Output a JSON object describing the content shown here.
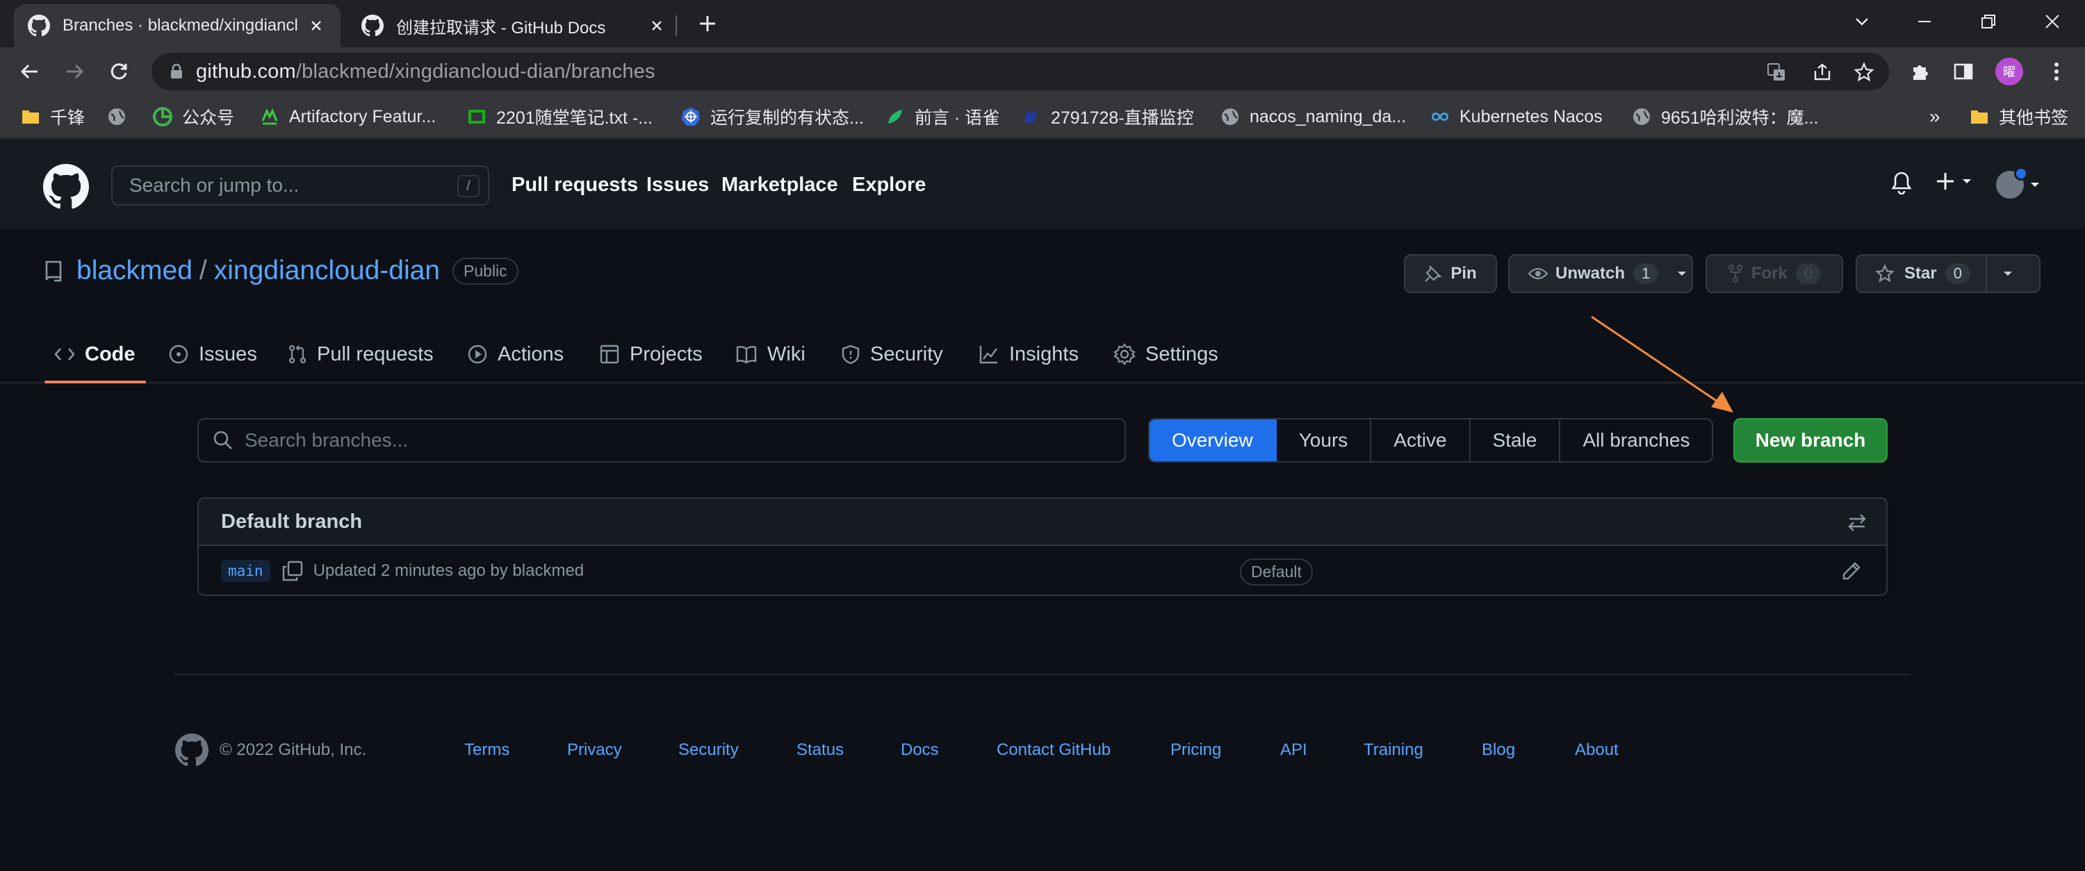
{
  "browser": {
    "tabs": [
      {
        "title": "Branches · blackmed/xingdiancloud-dian",
        "active": true
      },
      {
        "title": "创建拉取请求 - GitHub Docs",
        "active": false
      }
    ],
    "url_host": "github.com",
    "url_path": "/blackmed/xingdiancloud-dian/branches",
    "profile_initial": "曜",
    "bookmarks": [
      {
        "label": "千锋",
        "icon": "folder-icon"
      },
      {
        "label": "",
        "icon": "globe-icon"
      },
      {
        "label": "公众号",
        "icon": "wechat-icon"
      },
      {
        "label": "Artifactory Featur...",
        "icon": "artifactory-icon"
      },
      {
        "label": "2201随堂笔记.txt -...",
        "icon": "note-icon"
      },
      {
        "label": "运行复制的有状态...",
        "icon": "kubernetes-icon"
      },
      {
        "label": "前言 · 语雀",
        "icon": "yuque-icon"
      },
      {
        "label": "2791728-直播监控",
        "icon": "live-icon"
      },
      {
        "label": "nacos_naming_da...",
        "icon": "globe-icon"
      },
      {
        "label": "Kubernetes Nacos",
        "icon": "infinity-icon"
      },
      {
        "label": "9651哈利波特：魔...",
        "icon": "globe-icon"
      },
      {
        "label": "其他书签",
        "icon": "folder-icon"
      }
    ],
    "more_bookmarks": "»"
  },
  "github": {
    "search_placeholder": "Search or jump to...",
    "search_shortcut": "/",
    "nav": [
      "Pull requests",
      "Issues",
      "Marketplace",
      "Explore"
    ]
  },
  "repo": {
    "owner": "blackmed",
    "separator": "/",
    "name": "xingdiancloud-dian",
    "visibility": "Public",
    "pin_label": "Pin",
    "unwatch_label": "Unwatch",
    "unwatch_count": "1",
    "fork_label": "Fork",
    "fork_count": "0",
    "star_label": "Star",
    "star_count": "0",
    "tabs": [
      "Code",
      "Issues",
      "Pull requests",
      "Actions",
      "Projects",
      "Wiki",
      "Security",
      "Insights",
      "Settings"
    ]
  },
  "branches": {
    "search_placeholder": "Search branches...",
    "filters": [
      "Overview",
      "Yours",
      "Active",
      "Stale",
      "All branches"
    ],
    "selected_filter": "Overview",
    "new_branch_label": "New branch",
    "default_header": "Default branch",
    "default_branch": {
      "name": "main",
      "updated": "Updated 2 minutes ago by blackmed",
      "badge": "Default"
    }
  },
  "footer": {
    "copyright": "© 2022 GitHub, Inc.",
    "links": [
      "Terms",
      "Privacy",
      "Security",
      "Status",
      "Docs",
      "Contact GitHub",
      "Pricing",
      "API",
      "Training",
      "Blog",
      "About"
    ]
  },
  "colors": {
    "accent_blue": "#1f6feb",
    "link_blue": "#58a6ff",
    "new_branch_green": "#238636",
    "tab_underline": "#f78166",
    "arrow": "#f08a3c"
  }
}
